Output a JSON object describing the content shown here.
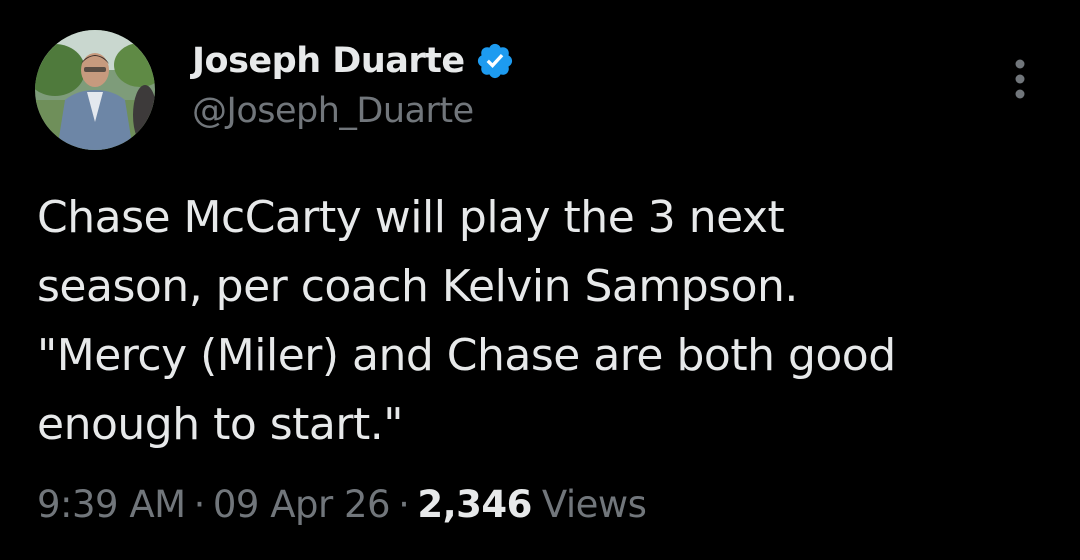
{
  "author": {
    "display_name": "Joseph Duarte",
    "handle": "@Joseph_Duarte",
    "verified": true
  },
  "tweet": {
    "lines": [
      "Chase McCarty will play the 3 next",
      "season, per coach Kelvin Sampson.",
      "\"Mercy (Miler) and Chase are both good",
      "enough to start.\""
    ]
  },
  "meta": {
    "time": "9:39 AM",
    "separator": "·",
    "date": "09 Apr 26",
    "views_count": "2,346",
    "views_label": "Views"
  },
  "icons": {
    "verified": "verified-badge-icon",
    "more": "more-options-icon"
  },
  "colors": {
    "background": "#000000",
    "primary_text": "#e7e9ea",
    "secondary_text": "#71767b",
    "verified_blue": "#1d9bf0"
  }
}
